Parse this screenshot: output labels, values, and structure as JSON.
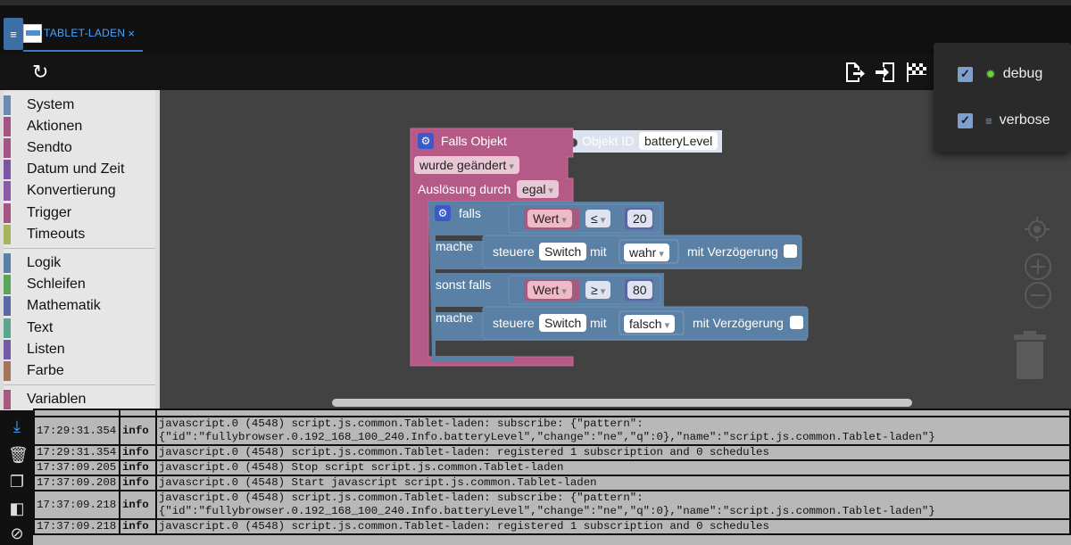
{
  "tab": {
    "label": "TABLET-LADEN",
    "close": "×"
  },
  "toolbar": {
    "refresh_icon": "refresh-icon",
    "icons": [
      "export-icon",
      "import-icon",
      "flag-icon"
    ]
  },
  "categories": [
    {
      "label": "System",
      "color": "#6b8cb2"
    },
    {
      "label": "Aktionen",
      "color": "#a45584"
    },
    {
      "label": "Sendto",
      "color": "#a45584"
    },
    {
      "label": "Datum und Zeit",
      "color": "#7a55a4"
    },
    {
      "label": "Konvertierung",
      "color": "#8a5aa8"
    },
    {
      "label": "Trigger",
      "color": "#a45584"
    },
    {
      "label": "Timeouts",
      "color": "#a5b55e"
    },
    {
      "label": "Logik",
      "color": "#5b80a5"
    },
    {
      "label": "Schleifen",
      "color": "#5ba55b"
    },
    {
      "label": "Mathematik",
      "color": "#5b67a5"
    },
    {
      "label": "Text",
      "color": "#5ba58c"
    },
    {
      "label": "Listen",
      "color": "#745ba5"
    },
    {
      "label": "Farbe",
      "color": "#a5745b"
    },
    {
      "label": "Variablen",
      "color": "#a55b80"
    }
  ],
  "blocks": {
    "trigger_title": "Falls Objekt",
    "object_id_label": "Objekt ID",
    "object_id_value": "batteryLevel",
    "changed_dd": "wurde geändert",
    "trigger_by_label": "Auslösung durch",
    "trigger_by_value": "egal",
    "if_label": "falls",
    "then_label": "mache",
    "elseif_label": "sonst falls",
    "then2_label": "mache",
    "cond1_var": "Wert",
    "cond1_op": "≤",
    "cond1_num": "20",
    "cond2_var": "Wert",
    "cond2_op": "≥",
    "cond2_num": "80",
    "set1_label": "steuere",
    "set1_target": "Switch",
    "set1_with": "mit",
    "set1_value": "wahr",
    "set1_delay": "mit Verzögerung",
    "set2_label": "steuere",
    "set2_target": "Switch",
    "set2_with": "mit",
    "set2_value": "falsch",
    "set2_delay": "mit Verzögerung"
  },
  "popup": {
    "debug_label": "debug",
    "verbose_label": "verbose"
  },
  "log_sidebar_icons": [
    "scroll-down-icon",
    "clear-log-icon",
    "copy-icon",
    "log-width-icon",
    "hide-icon"
  ],
  "log_rows": [
    {
      "time": "17:29:31.354",
      "severity": "info",
      "message": "javascript.0 (4548) script.js.common.Tablet-laden: subscribe: {\"pattern\":\n{\"id\":\"fullybrowser.0.192_168_100_240.Info.batteryLevel\",\"change\":\"ne\",\"q\":0},\"name\":\"script.js.common.Tablet-laden\"}"
    },
    {
      "time": "17:29:31.354",
      "severity": "info",
      "message": "javascript.0 (4548) script.js.common.Tablet-laden: registered 1 subscription and 0 schedules"
    },
    {
      "time": "17:37:09.205",
      "severity": "info",
      "message": "javascript.0 (4548) Stop script script.js.common.Tablet-laden"
    },
    {
      "time": "17:37:09.208",
      "severity": "info",
      "message": "javascript.0 (4548) Start javascript script.js.common.Tablet-laden"
    },
    {
      "time": "17:37:09.218",
      "severity": "info",
      "message": "javascript.0 (4548) script.js.common.Tablet-laden: subscribe: {\"pattern\":\n{\"id\":\"fullybrowser.0.192_168_100_240.Info.batteryLevel\",\"change\":\"ne\",\"q\":0},\"name\":\"script.js.common.Tablet-laden\"}"
    },
    {
      "time": "17:37:09.218",
      "severity": "info",
      "message": "javascript.0 (4548) script.js.common.Tablet-laden: registered 1 subscription and 0 schedules"
    }
  ]
}
